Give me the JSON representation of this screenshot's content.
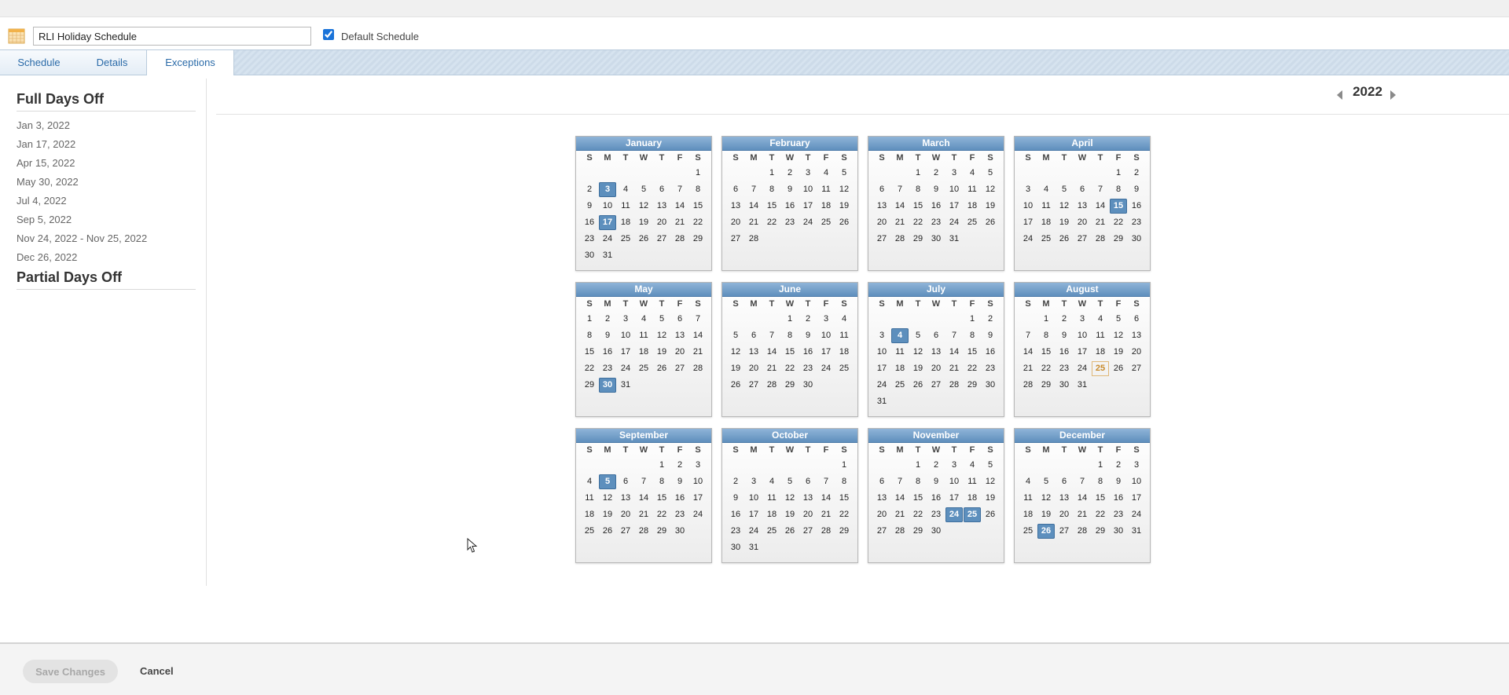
{
  "header": {
    "schedule_name": "RLI Holiday Schedule",
    "default_schedule_label": "Default Schedule",
    "default_schedule_checked": true,
    "icon": "calendar-icon"
  },
  "tabs": [
    {
      "label": "Schedule",
      "active": false
    },
    {
      "label": "Details",
      "active": false
    },
    {
      "label": "Exceptions",
      "active": true
    }
  ],
  "sidebar": {
    "full_days_heading": "Full Days Off",
    "full_days": [
      "Jan 3, 2022",
      "Jan 17, 2022",
      "Apr 15, 2022",
      "May 30, 2022",
      "Jul 4, 2022",
      "Sep 5, 2022",
      "Nov 24, 2022 - Nov 25, 2022",
      "Dec 26, 2022"
    ],
    "partial_days_heading": "Partial Days Off"
  },
  "year_nav": {
    "year": "2022",
    "prev_icon": "left-triangle-icon",
    "next_icon": "right-triangle-icon"
  },
  "calendar": {
    "weekday_labels": [
      "S",
      "M",
      "T",
      "W",
      "T",
      "F",
      "S"
    ],
    "months": [
      {
        "name": "January",
        "first_weekday": 6,
        "days": 31,
        "selected": [
          3,
          17
        ],
        "highlighted": []
      },
      {
        "name": "February",
        "first_weekday": 2,
        "days": 28,
        "selected": [],
        "highlighted": []
      },
      {
        "name": "March",
        "first_weekday": 2,
        "days": 31,
        "selected": [],
        "highlighted": []
      },
      {
        "name": "April",
        "first_weekday": 5,
        "days": 30,
        "selected": [
          15
        ],
        "highlighted": []
      },
      {
        "name": "May",
        "first_weekday": 0,
        "days": 31,
        "selected": [
          30
        ],
        "highlighted": []
      },
      {
        "name": "June",
        "first_weekday": 3,
        "days": 30,
        "selected": [],
        "highlighted": []
      },
      {
        "name": "July",
        "first_weekday": 5,
        "days": 31,
        "selected": [
          4
        ],
        "highlighted": []
      },
      {
        "name": "August",
        "first_weekday": 1,
        "days": 31,
        "selected": [],
        "highlighted": [
          25
        ]
      },
      {
        "name": "September",
        "first_weekday": 4,
        "days": 30,
        "selected": [
          5
        ],
        "highlighted": []
      },
      {
        "name": "October",
        "first_weekday": 6,
        "days": 31,
        "selected": [],
        "highlighted": []
      },
      {
        "name": "November",
        "first_weekday": 2,
        "days": 30,
        "selected": [
          24,
          25
        ],
        "highlighted": []
      },
      {
        "name": "December",
        "first_weekday": 4,
        "days": 31,
        "selected": [
          26
        ],
        "highlighted": []
      }
    ],
    "colors": {
      "selected": "#5d8fbd",
      "today_outline": "#e0b878",
      "header": "#6f9cc8"
    }
  },
  "footer": {
    "save_label": "Save Changes",
    "save_disabled": true,
    "cancel_label": "Cancel"
  }
}
